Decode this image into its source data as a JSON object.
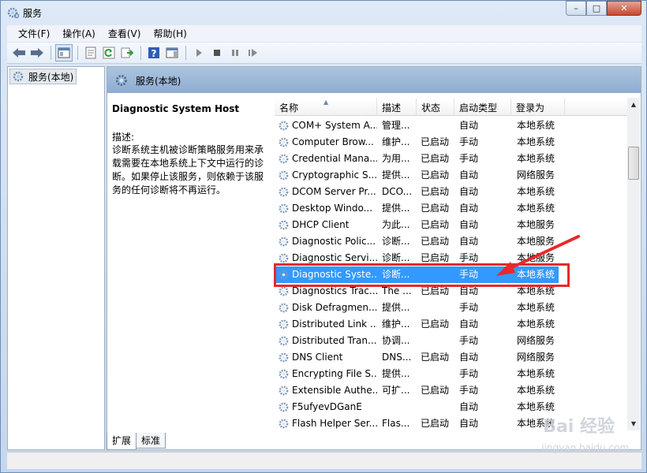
{
  "window": {
    "title": "服务",
    "buttons": {
      "minimize": "–",
      "maximize": "□",
      "close": "✕"
    }
  },
  "menu": [
    "文件(F)",
    "操作(A)",
    "查看(V)",
    "帮助(H)"
  ],
  "tree": {
    "item": "服务(本地)"
  },
  "pane": {
    "header": "服务(本地)",
    "desc_title": "Diagnostic System Host",
    "desc_label": "描述:",
    "desc_body": "诊断系统主机被诊断策略服务用来承载需要在本地系统上下文中运行的诊断。如果停止该服务，则依赖于该服务的任何诊断将不再运行。"
  },
  "columns": [
    "名称",
    "描述",
    "状态",
    "启动类型",
    "登录为"
  ],
  "rows": [
    {
      "name": "COM+ System A...",
      "desc": "管理...",
      "status": "",
      "startup": "自动",
      "logon": "本地系统"
    },
    {
      "name": "Computer Brow...",
      "desc": "维护...",
      "status": "已启动",
      "startup": "手动",
      "logon": "本地系统"
    },
    {
      "name": "Credential Mana...",
      "desc": "为用...",
      "status": "已启动",
      "startup": "手动",
      "logon": "本地系统"
    },
    {
      "name": "Cryptographic S...",
      "desc": "提供...",
      "status": "已启动",
      "startup": "自动",
      "logon": "网络服务"
    },
    {
      "name": "DCOM Server Pr...",
      "desc": "DCO...",
      "status": "已启动",
      "startup": "自动",
      "logon": "本地系统"
    },
    {
      "name": "Desktop Windo...",
      "desc": "提供...",
      "status": "已启动",
      "startup": "自动",
      "logon": "本地系统"
    },
    {
      "name": "DHCP Client",
      "desc": "为此...",
      "status": "已启动",
      "startup": "自动",
      "logon": "本地服务"
    },
    {
      "name": "Diagnostic Polic...",
      "desc": "诊断...",
      "status": "已启动",
      "startup": "自动",
      "logon": "本地服务"
    },
    {
      "name": "Diagnostic Servi...",
      "desc": "诊断...",
      "status": "已启动",
      "startup": "手动",
      "logon": "本地服务"
    },
    {
      "name": "Diagnostic Syste...",
      "desc": "诊断...",
      "status": "",
      "startup": "手动",
      "logon": "本地系统"
    },
    {
      "name": "Diagnostics Trac...",
      "desc": "The ...",
      "status": "已启动",
      "startup": "自动",
      "logon": "本地系统"
    },
    {
      "name": "Disk Defragmen...",
      "desc": "提供...",
      "status": "",
      "startup": "手动",
      "logon": "本地系统"
    },
    {
      "name": "Distributed Link ...",
      "desc": "维护...",
      "status": "已启动",
      "startup": "自动",
      "logon": "本地系统"
    },
    {
      "name": "Distributed Tran...",
      "desc": "协调...",
      "status": "",
      "startup": "手动",
      "logon": "网络服务"
    },
    {
      "name": "DNS Client",
      "desc": "DNS...",
      "status": "已启动",
      "startup": "自动",
      "logon": "网络服务"
    },
    {
      "name": "Encrypting File S...",
      "desc": "提供...",
      "status": "",
      "startup": "手动",
      "logon": "本地系统"
    },
    {
      "name": "Extensible Authe...",
      "desc": "可扩...",
      "status": "已启动",
      "startup": "手动",
      "logon": "本地系统"
    },
    {
      "name": "F5ufyevDGanE",
      "desc": "",
      "status": "",
      "startup": "自动",
      "logon": "本地系统"
    },
    {
      "name": "Flash Helper Ser...",
      "desc": "Flas...",
      "status": "已启动",
      "startup": "自动",
      "logon": "本地系统"
    }
  ],
  "selected_row": 9,
  "tabs": [
    "扩展",
    "标准"
  ],
  "watermark": {
    "text": "Bai 经验",
    "sub": "jingyan.baidu.com"
  },
  "colors": {
    "selection": "#3399ff",
    "highlight_box": "#e8282b"
  }
}
